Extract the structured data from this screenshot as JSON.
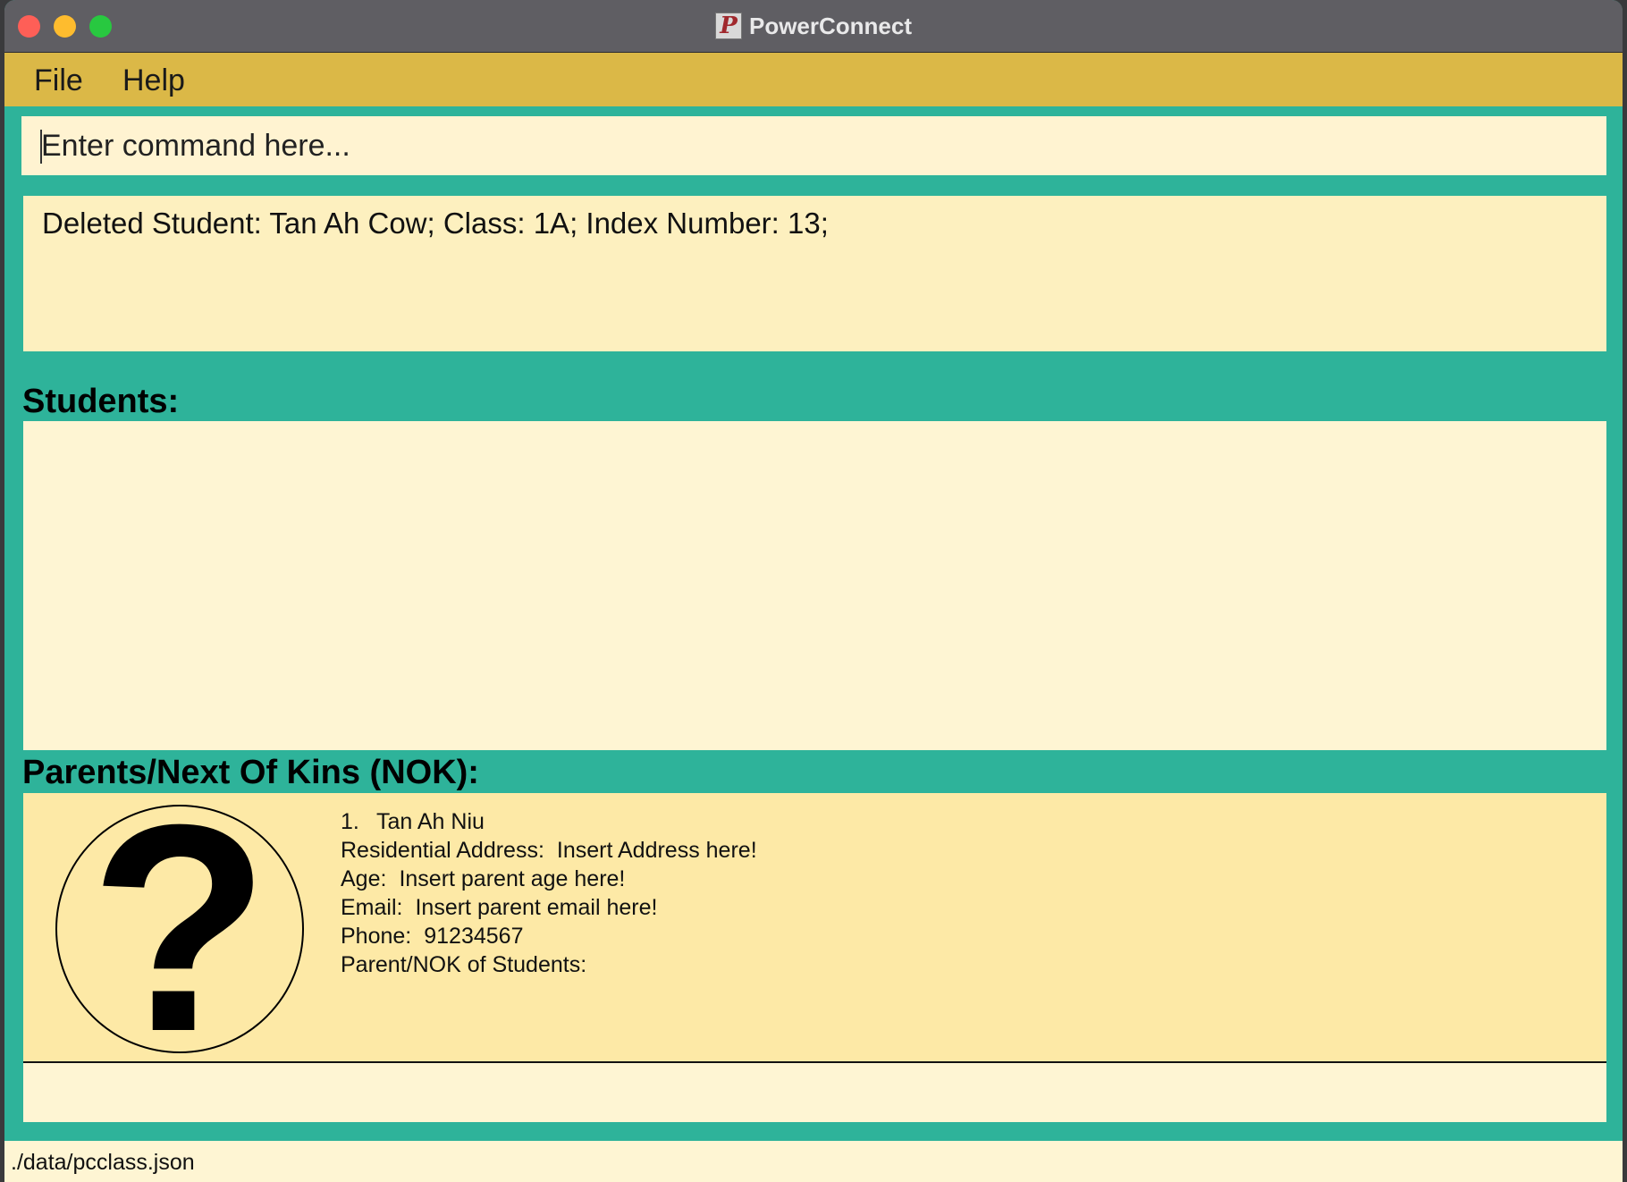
{
  "window": {
    "title": "PowerConnect",
    "app_icon_letter": "P"
  },
  "menu": {
    "file": "File",
    "help": "Help"
  },
  "command": {
    "placeholder": "Enter command here...",
    "value": ""
  },
  "result": {
    "message": "Deleted Student: Tan Ah Cow; Class: 1A; Index Number: 13;"
  },
  "students": {
    "heading": "Students:",
    "items": []
  },
  "nok": {
    "heading": "Parents/Next Of Kins (NOK):",
    "items": [
      {
        "index": "1.",
        "name": "Tan Ah Niu",
        "address_label": "Residential Address:",
        "address": "Insert Address here!",
        "age_label": "Age:",
        "age": "Insert parent age here!",
        "email_label": "Email:",
        "email": "Insert parent email here!",
        "phone_label": "Phone:",
        "phone": "91234567",
        "students_label": "Parent/NOK of Students:",
        "avatar_icon": "question-mark-icon"
      }
    ]
  },
  "status": {
    "path": "./data/pcclass.json"
  },
  "colors": {
    "accent_teal": "#2eb39a",
    "menubar": "#dbb847",
    "panel": "#fef5d3",
    "card": "#fde9a6"
  }
}
